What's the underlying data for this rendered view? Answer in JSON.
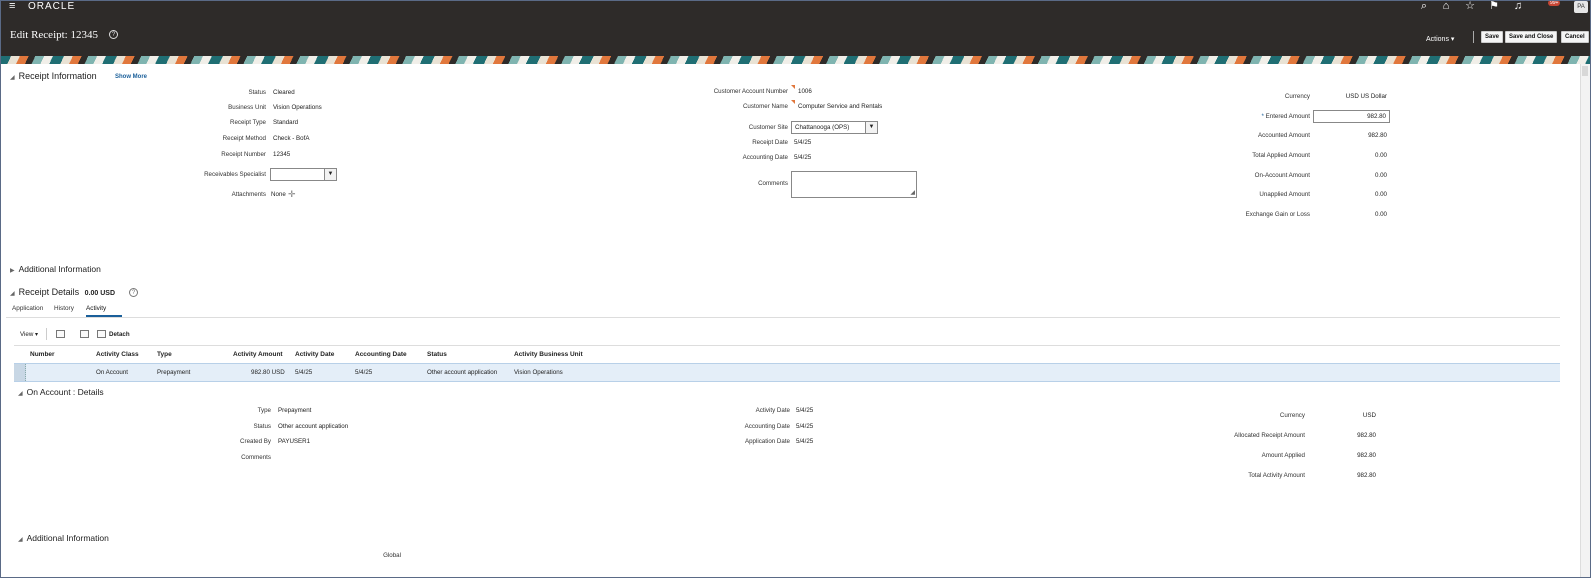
{
  "topbar": {
    "brand": "ORACLE",
    "notifications_count": "99+",
    "avatar": "PA",
    "icons": [
      "menu-icon",
      "search-icon",
      "home-icon",
      "star-icon",
      "flag-icon",
      "bell-icon"
    ]
  },
  "header": {
    "title": "Edit Receipt: 12345",
    "actions_label": "Actions ▾",
    "save_label": "Save",
    "save_close_label": "Save and Close",
    "cancel_label": "Cancel"
  },
  "receipt_info": {
    "section_title": "Receipt Information",
    "show_more": "Show More",
    "left": {
      "status_label": "Status",
      "status_value": "Cleared",
      "bu_label": "Business Unit",
      "bu_value": "Vision Operations",
      "type_label": "Receipt Type",
      "type_value": "Standard",
      "method_label": "Receipt Method",
      "method_value": "Check - BofA",
      "number_label": "Receipt Number",
      "number_value": "12345",
      "specialist_label": "Receivables Specialist",
      "specialist_value": "",
      "attachments_label": "Attachments",
      "attachments_value": "None"
    },
    "middle": {
      "acct_label": "Customer Account Number",
      "acct_value": "1006",
      "name_label": "Customer Name",
      "name_value": "Computer Service and Rentals",
      "site_label": "Customer Site",
      "site_value": "Chattanooga (OPS)",
      "receipt_date_label": "Receipt Date",
      "receipt_date_value": "5/4/25",
      "acct_date_label": "Accounting Date",
      "acct_date_value": "5/4/25",
      "comments_label": "Comments"
    },
    "right": {
      "currency_label": "Currency",
      "currency_value": "USD US Dollar",
      "entered_label": "Entered Amount",
      "entered_value": "982.80",
      "accounted_label": "Accounted Amount",
      "accounted_value": "982.80",
      "applied_label": "Total Applied Amount",
      "applied_value": "0.00",
      "on_account_label": "On-Account Amount",
      "on_account_value": "0.00",
      "unapplied_label": "Unapplied Amount",
      "unapplied_value": "0.00",
      "gain_loss_label": "Exchange Gain or Loss",
      "gain_loss_value": "0.00"
    }
  },
  "additional_info": {
    "title": "Additional Information"
  },
  "receipt_details": {
    "title": "Receipt Details",
    "amount": "0.00 USD",
    "tabs": [
      "Application",
      "History",
      "Activity"
    ],
    "toolbar": {
      "view": "View ▾",
      "detach": "Detach"
    },
    "columns": [
      "Number",
      "Activity Class",
      "Type",
      "Activity Amount",
      "Activity Date",
      "Accounting Date",
      "Status",
      "Activity Business Unit"
    ],
    "rows": [
      {
        "number": "",
        "activity_class": "On Account",
        "type": "Prepayment",
        "amount": "982.80 USD",
        "activity_date": "5/4/25",
        "accounting_date": "5/4/25",
        "status": "Other account application",
        "business_unit": "Vision Operations"
      }
    ]
  },
  "on_account": {
    "title": "On Account : Details",
    "type_label": "Type",
    "type_value": "Prepayment",
    "status_label": "Status",
    "status_value": "Other account application",
    "created_label": "Created By",
    "created_value": "PAYUSER1",
    "comments_label": "Comments",
    "activity_date_label": "Activity Date",
    "activity_date_value": "5/4/25",
    "acct_date_label": "Accounting Date",
    "acct_date_value": "5/4/25",
    "app_date_label": "Application Date",
    "app_date_value": "5/4/25",
    "currency_label": "Currency",
    "currency_value": "USD",
    "allocated_label": "Allocated Receipt Amount",
    "allocated_value": "982.80",
    "applied_label": "Amount Applied",
    "applied_value": "982.80",
    "total_label": "Total Activity Amount",
    "total_value": "982.80"
  },
  "additional_info_2": {
    "title": "Additional Information",
    "global_label": "Global"
  }
}
